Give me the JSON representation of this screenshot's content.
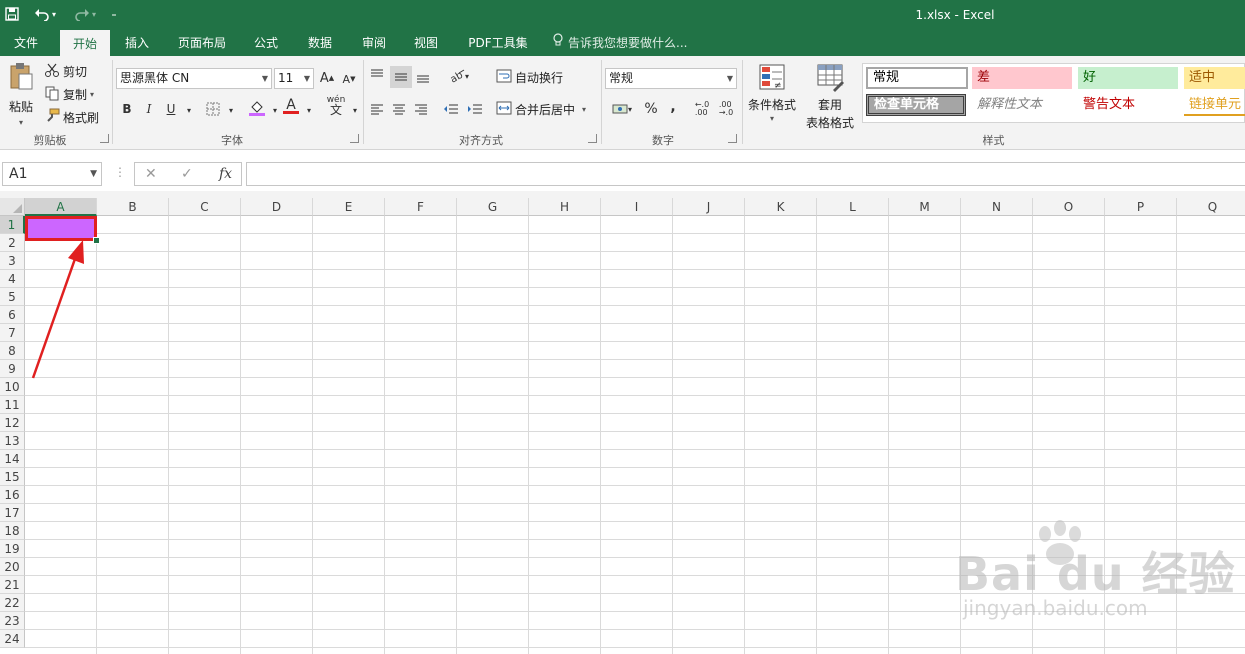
{
  "window": {
    "title": "1.xlsx - Excel"
  },
  "quick_access": {
    "save_icon": "save-icon",
    "undo_icon": "undo-icon",
    "redo_icon": "redo-icon",
    "customize_icon": "customize-icon"
  },
  "tabs": [
    {
      "label": "文件"
    },
    {
      "label": "开始"
    },
    {
      "label": "插入"
    },
    {
      "label": "页面布局"
    },
    {
      "label": "公式"
    },
    {
      "label": "数据"
    },
    {
      "label": "审阅"
    },
    {
      "label": "视图"
    },
    {
      "label": "PDF工具集"
    }
  ],
  "tell_me": "告诉我您想要做什么...",
  "clipboard": {
    "paste": "粘贴",
    "cut": "剪切",
    "copy": "复制",
    "format_painter": "格式刷",
    "group_label": "剪贴板"
  },
  "font": {
    "name": "思源黑体 CN",
    "size": "11",
    "bold": "B",
    "italic": "I",
    "underline": "U",
    "font_color_letter": "A",
    "wen": "wén",
    "wen_char": "文",
    "group_label": "字体",
    "fill_color": "#cc66ff",
    "font_color": "#e02020"
  },
  "alignment": {
    "wrap_text": "自动换行",
    "merge_center": "合并后居中",
    "group_label": "对齐方式"
  },
  "number": {
    "format": "常规",
    "percent": "%",
    "comma": ",",
    "group_label": "数字"
  },
  "styles": {
    "conditional_format": "条件格式",
    "format_as_table_1": "套用",
    "format_as_table_2": "表格格式",
    "cells": [
      {
        "label": "常规"
      },
      {
        "label": "差"
      },
      {
        "label": "好"
      },
      {
        "label": "适中"
      },
      {
        "label": "检查单元格"
      },
      {
        "label": "解释性文本"
      },
      {
        "label": "警告文本"
      },
      {
        "label": "链接单元"
      }
    ],
    "group_label": "样式"
  },
  "formula_bar": {
    "name_box": "A1",
    "cancel": "✕",
    "enter": "✓",
    "fx": "fx",
    "value": ""
  },
  "sheet": {
    "columns": [
      "A",
      "B",
      "C",
      "D",
      "E",
      "F",
      "G",
      "H",
      "I",
      "J",
      "K",
      "L",
      "M",
      "N",
      "O",
      "P",
      "Q"
    ],
    "rows": [
      "1",
      "2",
      "3",
      "4",
      "5",
      "6",
      "7",
      "8",
      "9",
      "10",
      "11",
      "12",
      "13",
      "14",
      "15",
      "16",
      "17",
      "18",
      "19",
      "20",
      "21",
      "22",
      "23",
      "24"
    ],
    "selected_cell": "A1",
    "selected_fill": "#cc66ff",
    "annotation_color": "#e02020"
  },
  "watermark": {
    "brand": "Bai du 经验",
    "url": "jingyan.baidu.com"
  }
}
